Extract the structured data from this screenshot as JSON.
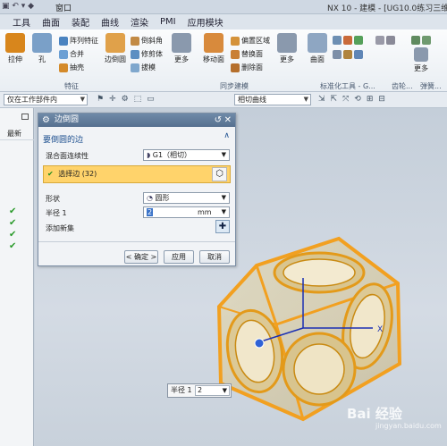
{
  "titlebar": {
    "window_menu": "窗口",
    "app_title": "NX 10 - 建模 - [UG10.0练习三维建"
  },
  "tabs": [
    "工具",
    "曲面",
    "装配",
    "曲线",
    "渲染",
    "PMI",
    "应用模块"
  ],
  "ribbon": {
    "big": [
      {
        "label": "拉伸",
        "color": "#d8861c"
      },
      {
        "label": "孔",
        "color": "#7aa0c8"
      },
      {
        "label": "边倒圆",
        "color": "#e0a14a"
      },
      {
        "label": "更多",
        "color": "#8a99ad"
      },
      {
        "label": "移动面",
        "color": "#d88a3c"
      },
      {
        "label": "更多",
        "color": "#8a99ad"
      },
      {
        "label": "曲面",
        "color": "#8ea6c2"
      },
      {
        "label": "更多",
        "color": "#8a99ad"
      }
    ],
    "small": [
      {
        "label": "阵列特征",
        "color": "#4a83c0"
      },
      {
        "label": "合并",
        "color": "#6b9fd4"
      },
      {
        "label": "抽壳",
        "color": "#d48a2a"
      },
      {
        "label": "倒斜角",
        "color": "#c28a44"
      },
      {
        "label": "修剪体",
        "color": "#5d8fc2"
      },
      {
        "label": "拔模",
        "color": "#7fa7cd"
      },
      {
        "label": "偏置区域",
        "color": "#d4923a"
      },
      {
        "label": "替换面",
        "color": "#c97f35"
      },
      {
        "label": "删除面",
        "color": "#b56f2c"
      }
    ],
    "group_labels": [
      "特征",
      "同步建模",
      "标准化工具 - G...",
      "齿轮...",
      "弹簧..."
    ]
  },
  "selection_bar": {
    "filter": "仅在工作部件内",
    "curve_rule": "相切曲线"
  },
  "navigator": {
    "column_header": "最新",
    "checks": [
      "✔",
      "✔",
      "✔",
      "✔"
    ]
  },
  "dialog": {
    "title": "边倒圆",
    "section": "要倒圆的边",
    "continuity_label": "混合面连续性",
    "continuity_value": "G1（相切）",
    "select_edge": "选择边 (32)",
    "shape_label": "形状",
    "shape_value": "圆形",
    "radius_label": "半径 1",
    "radius_value": "2",
    "radius_unit": "mm",
    "add_set_label": "添加新集",
    "ok": "< 确定 >",
    "apply": "应用",
    "cancel": "取消"
  },
  "handle": {
    "label": "半径 1",
    "value": "2"
  },
  "axis_label": "X",
  "watermark": "Bai 经验",
  "watermark_sub": "jingyan.baidu.com"
}
